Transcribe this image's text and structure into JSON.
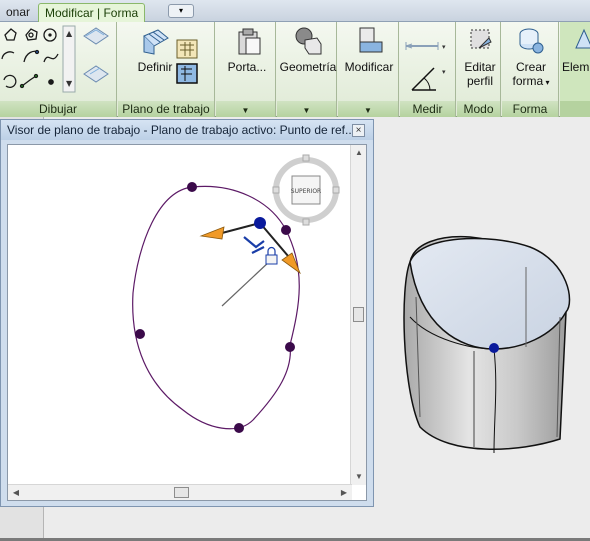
{
  "tabs": {
    "partial_left": "onar",
    "modify_form": "Modificar | Forma",
    "qa_symbol": "▾"
  },
  "ribbon": {
    "panels": {
      "draw": "Dibujar",
      "workplane": "Plano de trabajo",
      "measure": "Medir",
      "mode": "Modo",
      "form": "Forma"
    },
    "buttons": {
      "define": "Definir",
      "clipboard": "Porta...",
      "geometry": "Geometría",
      "modify": "Modificar",
      "edit_profile_1": "Editar",
      "edit_profile_2": "perfil",
      "create_form_1": "Crear",
      "create_form_2": "forma",
      "element_partial": "Elem"
    }
  },
  "dialog": {
    "title": "Visor de plano de trabajo - Plano de trabajo activo: Punto de ref...",
    "close_symbol": "×",
    "viewcube_label": "SUPERIOR"
  },
  "colors": {
    "active_tab": "#e6f5d9",
    "ribbon_green": "#b5d29f",
    "curve": "#5c1a66",
    "point": "#3b0a4a",
    "selected_point": "#0a1a9c",
    "arrow": "#f09a28"
  }
}
